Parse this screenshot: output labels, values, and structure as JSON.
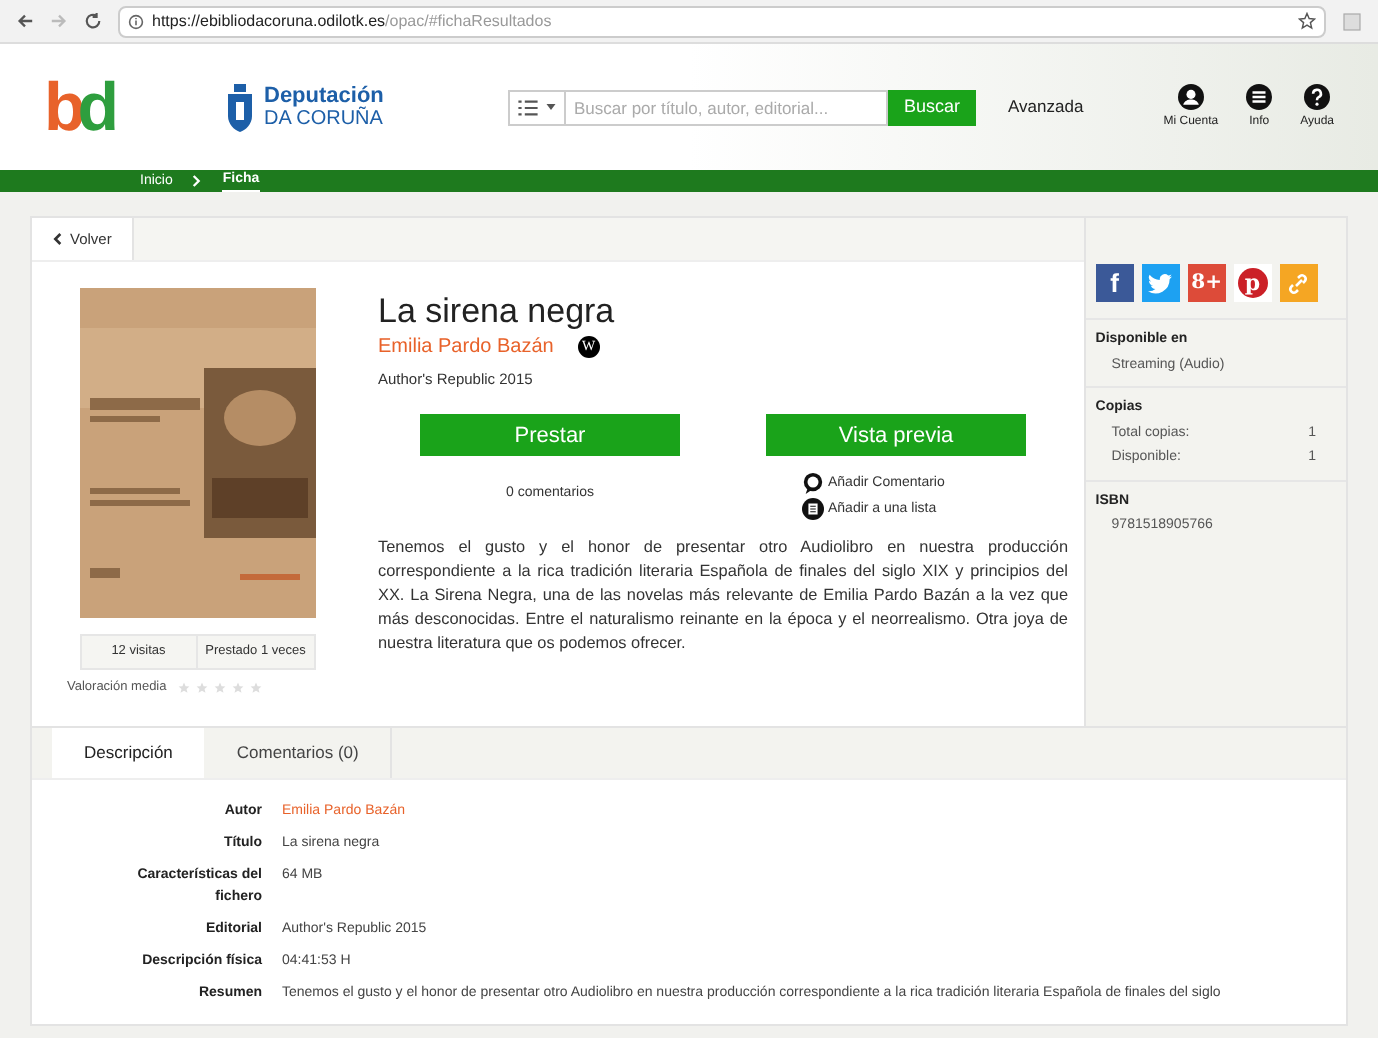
{
  "browser": {
    "url_host": "https://ebibliodacoruna.odilotk.es",
    "url_path": "/opac/#fichaResultados"
  },
  "header": {
    "logo": [
      {
        "text": "b",
        "color": "#e8622a"
      },
      {
        "text": "d",
        "color": "#2e9e3e"
      }
    ],
    "org_name": "Deputación",
    "org_sub": "DA CORUÑA",
    "search": {
      "placeholder": "Buscar por título, autor, editorial...",
      "button": "Buscar"
    },
    "advanced": "Avanzada",
    "user_links": [
      {
        "label": "Mi Cuenta",
        "kind": "user"
      },
      {
        "label": "Info",
        "kind": "menu"
      },
      {
        "label": "Ayuda",
        "kind": "help"
      }
    ]
  },
  "breadcrumb": [
    {
      "label": "Inicio",
      "selected": false
    },
    {
      "label": "Ficha",
      "selected": true
    }
  ],
  "back": "Volver",
  "book": {
    "title": "La sirena negra",
    "author": "Emilia Pardo Bazán",
    "wiki_badge": "W",
    "publisher": "Author's Republic 2015",
    "buttons": [
      "Prestar",
      "Vista previa"
    ],
    "comments": "0 comentarios",
    "links": [
      {
        "label": "Añadir Comentario",
        "kind": "comment"
      },
      {
        "label": "Añadir a una lista",
        "kind": "list"
      }
    ],
    "summary": "Tenemos el gusto y el honor de presentar otro Audiolibro en nuestra producción correspondiente a la rica tradición literaria Española de finales del siglo XIX y principios del XX. La Sirena Negra, una de las novelas más relevante de Emilia Pardo Bazán a la vez que más desconocidas. Entre el naturalismo reinante en la época y el neorrealismo. Otra joya de nuestra literatura que os podemos ofrecer.",
    "stats": [
      "12 visitas",
      "Prestado 1 veces"
    ],
    "rating": {
      "label": "Valoración media",
      "stars": 0
    }
  },
  "sidebar": {
    "share": [
      {
        "kind": "facebook",
        "glyph": "f",
        "color": "#3b5998"
      },
      {
        "kind": "twitter",
        "color": "#1da1f2"
      },
      {
        "kind": "googleplus",
        "glyph": "8+",
        "color": "#dd4b39"
      },
      {
        "kind": "pinterest",
        "glyph": "p",
        "color": "#cb2027"
      },
      {
        "kind": "link",
        "color": "#f5a623"
      }
    ],
    "available": {
      "heading": "Disponible en",
      "value": "Streaming (Audio)"
    },
    "copies": {
      "heading": "Copias",
      "rows": [
        {
          "label": "Total copias:",
          "value": "1"
        },
        {
          "label": "Disponible:",
          "value": "1"
        }
      ]
    },
    "isbn": {
      "heading": "ISBN",
      "value": "9781518905766"
    }
  },
  "tabs": [
    {
      "label": "Descripción",
      "selected": true
    },
    {
      "label": "Comentarios (0)",
      "selected": false
    }
  ],
  "details": [
    {
      "label": "Autor",
      "value": "Emilia Pardo Bazán",
      "kind": "link"
    },
    {
      "label": "Título",
      "value": "La sirena negra",
      "kind": "text"
    },
    {
      "label": "Características del fichero",
      "value": "64 MB",
      "kind": "text"
    },
    {
      "label": "Editorial",
      "value": "Author's Republic 2015",
      "kind": "text"
    },
    {
      "label": "Descripción física",
      "value": "04:41:53 H",
      "kind": "text"
    },
    {
      "label": "Resumen",
      "value": "Tenemos el gusto y el honor de presentar otro Audiolibro en nuestra producción correspondiente a la rica tradición literaria Española de finales del siglo",
      "kind": "text"
    }
  ]
}
